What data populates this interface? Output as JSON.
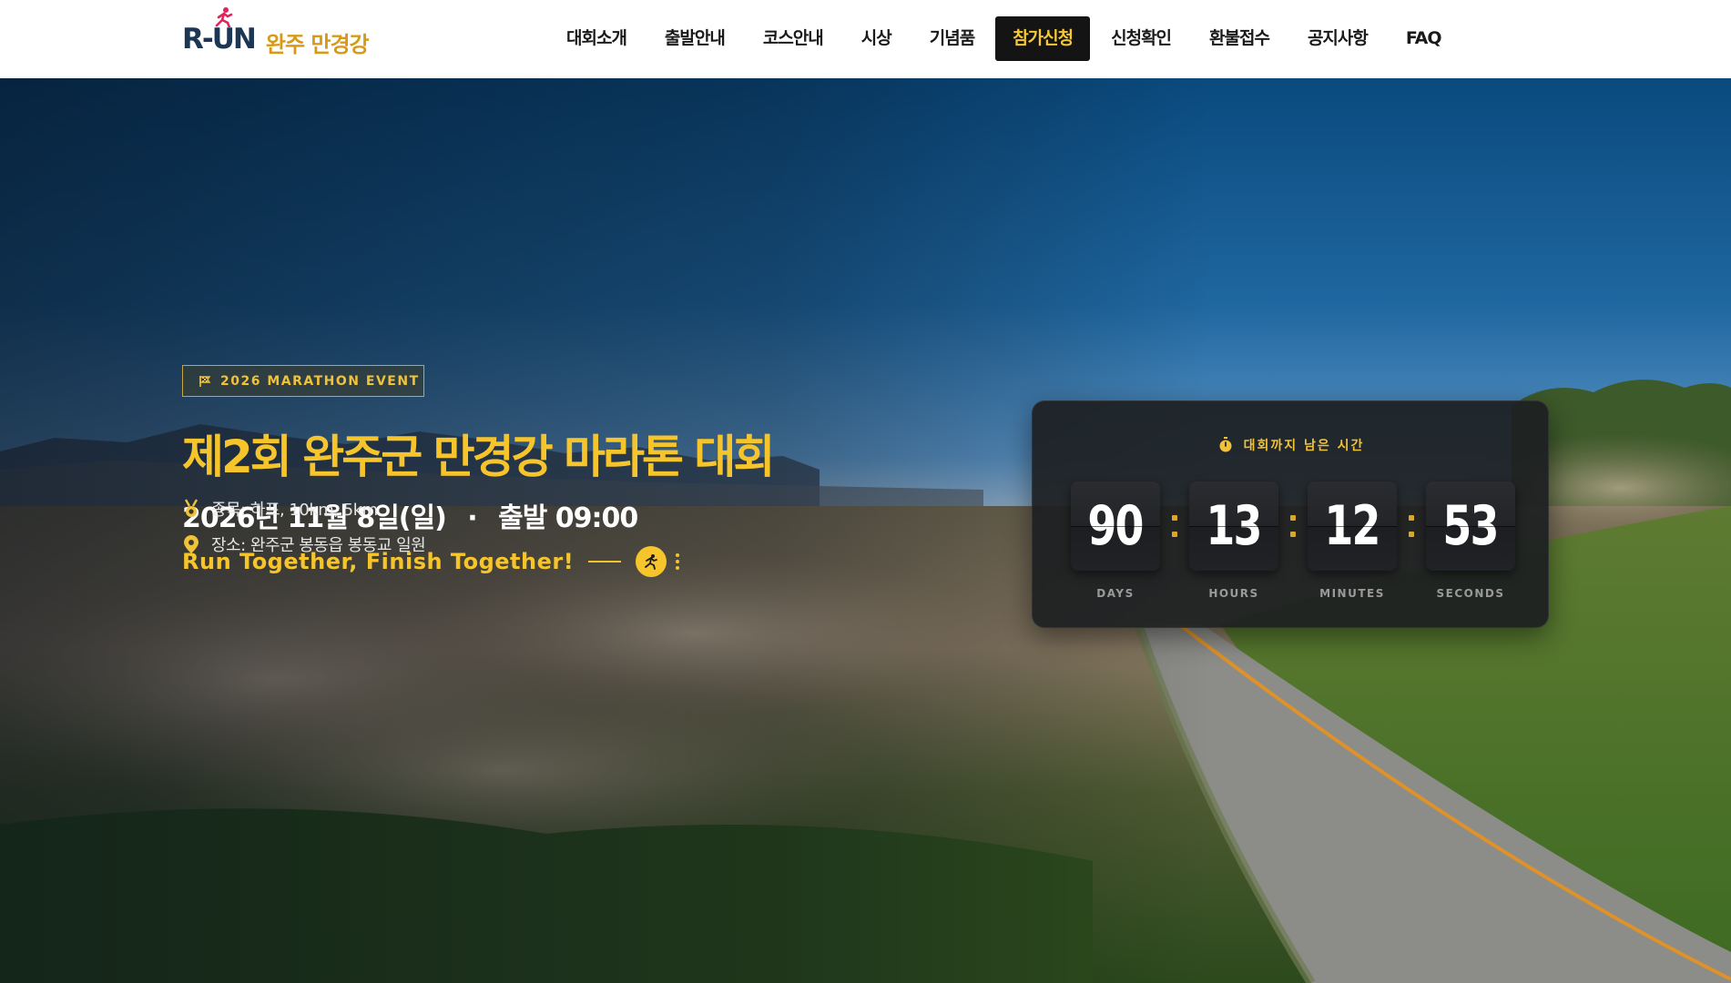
{
  "header": {
    "logo_mark": "R-UN",
    "logo_text": "완주 만경강",
    "nav": [
      {
        "label": "대회소개"
      },
      {
        "label": "출발안내"
      },
      {
        "label": "코스안내"
      },
      {
        "label": "시상"
      },
      {
        "label": "기념품"
      },
      {
        "label": "참가신청",
        "active": true
      },
      {
        "label": "신청확인"
      },
      {
        "label": "환불접수"
      },
      {
        "label": "공지사항"
      },
      {
        "label": "FAQ"
      }
    ]
  },
  "hero": {
    "badge": "2026 MARATHON EVENT",
    "title": "제2회 완주군 만경강 마라톤 대회",
    "date": "2026년 11월 8일(일)",
    "date_sep": "·",
    "start": "출발 09:00",
    "slogan": "Run Together, Finish Together!",
    "event_info": "종목: 하프, 10km, 5km",
    "location_info": "장소: 완주군 봉동읍 봉동교 일원"
  },
  "countdown": {
    "label": "대회까지 남은 시간",
    "days": "90",
    "days_label": "DAYS",
    "hours": "13",
    "hours_label": "HOURS",
    "minutes": "12",
    "minutes_label": "MINUTES",
    "seconds": "53",
    "seconds_label": "SECONDS"
  },
  "colors": {
    "accent": "#f6c52c",
    "nav_active_bg": "#141414",
    "logo_navy": "#1d3654",
    "logo_pink": "#e0245e"
  },
  "icons": {
    "badge": "flag-icon",
    "slogan": "runner-icon",
    "event": "medal-icon",
    "location": "map-pin-icon",
    "timer": "stopwatch-icon"
  }
}
